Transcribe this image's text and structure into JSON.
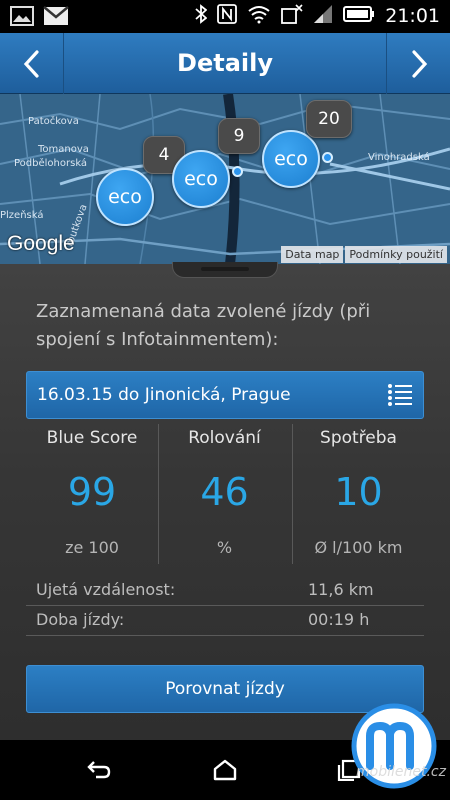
{
  "status_bar": {
    "time": "21:01",
    "left_icons": [
      "picture-icon",
      "gmail-icon"
    ],
    "right_icons": [
      "bluetooth-icon",
      "nfc-icon",
      "wifi-icon",
      "data-muted-icon",
      "signal-icon",
      "battery-icon"
    ]
  },
  "header": {
    "title": "Detaily",
    "back_icon": "chevron-left-icon",
    "forward_icon": "chevron-right-icon"
  },
  "map": {
    "streets": [
      "Patočkova",
      "Tomanova",
      "Podbělohorská",
      "Plzeňská",
      "Vinohradská",
      "routkova"
    ],
    "markers": [
      {
        "label": "eco",
        "count": "4"
      },
      {
        "label": "eco",
        "count": "9"
      },
      {
        "label": "eco",
        "count": "20"
      },
      {
        "label": "eco"
      }
    ],
    "google_logo": "Google",
    "data_link": "Data map",
    "terms_link": "Podmínky použití"
  },
  "intro_text": "Zaznamenaná data zvolené jízdy (při spojení s Infotainmentem):",
  "trip_selector": {
    "value": "16.03.15 do Jinonická, Prague",
    "icon": "list-icon"
  },
  "stats": [
    {
      "label": "Blue Score",
      "value": "99",
      "unit": "ze 100"
    },
    {
      "label": "Rolování",
      "value": "46",
      "unit": "%"
    },
    {
      "label": "Spotřeba",
      "value": "10",
      "unit": "Ø l/100 km"
    }
  ],
  "details": [
    {
      "label": "Ujetá vzdálenost:",
      "value": "11,6 km"
    },
    {
      "label": "Doba jízdy:",
      "value": "00:19 h"
    }
  ],
  "compare_button": "Porovnat jízdy",
  "nav": {
    "back_icon": "back-icon",
    "home_icon": "home-icon",
    "recent_icon": "recent-apps-icon"
  },
  "watermark": "mobilenet.cz",
  "colors": {
    "accent_blue": "#2272b6",
    "value_blue": "#2aa7e6",
    "content_bg": "#3a3a3a"
  }
}
